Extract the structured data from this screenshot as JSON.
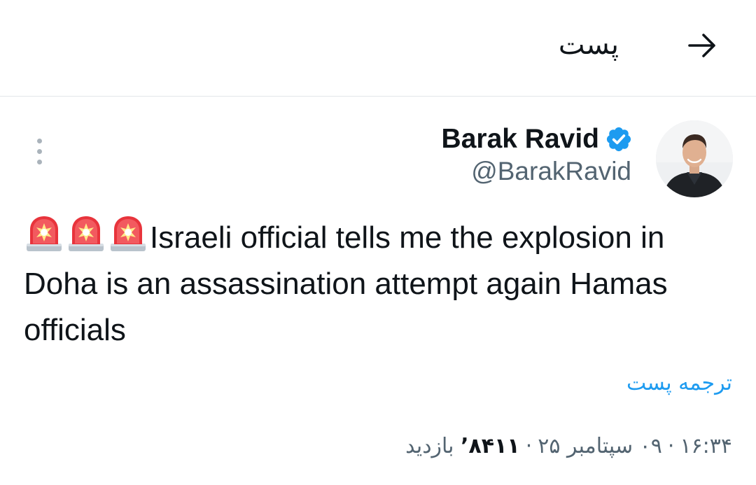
{
  "header": {
    "title": "پست",
    "back_icon": "arrow-right-icon"
  },
  "author": {
    "display_name": "Barak Ravid",
    "handle": "@BarakRavid",
    "verified": true,
    "verified_color": "#1d9bf0",
    "avatar_icon": "profile-photo"
  },
  "more_icon": "more-vertical-icon",
  "tweet": {
    "emoji_icon": "police-siren-emoji",
    "emoji_count": 3,
    "text": "Israeli official tells me the explosion in Doha is an assassination attempt again Hamas officials"
  },
  "translate_label": "ترجمه پست",
  "meta": {
    "time": "۱۶:۳۴",
    "date": "۰۹ سپتامبر ۲۵",
    "views_count": "۸۴۱۱’",
    "views_label": "بازدید",
    "separator": "·"
  },
  "colors": {
    "accent": "#1d9bf0",
    "text": "#0f1419",
    "secondary": "#536471",
    "divider": "#e3e6e9"
  }
}
